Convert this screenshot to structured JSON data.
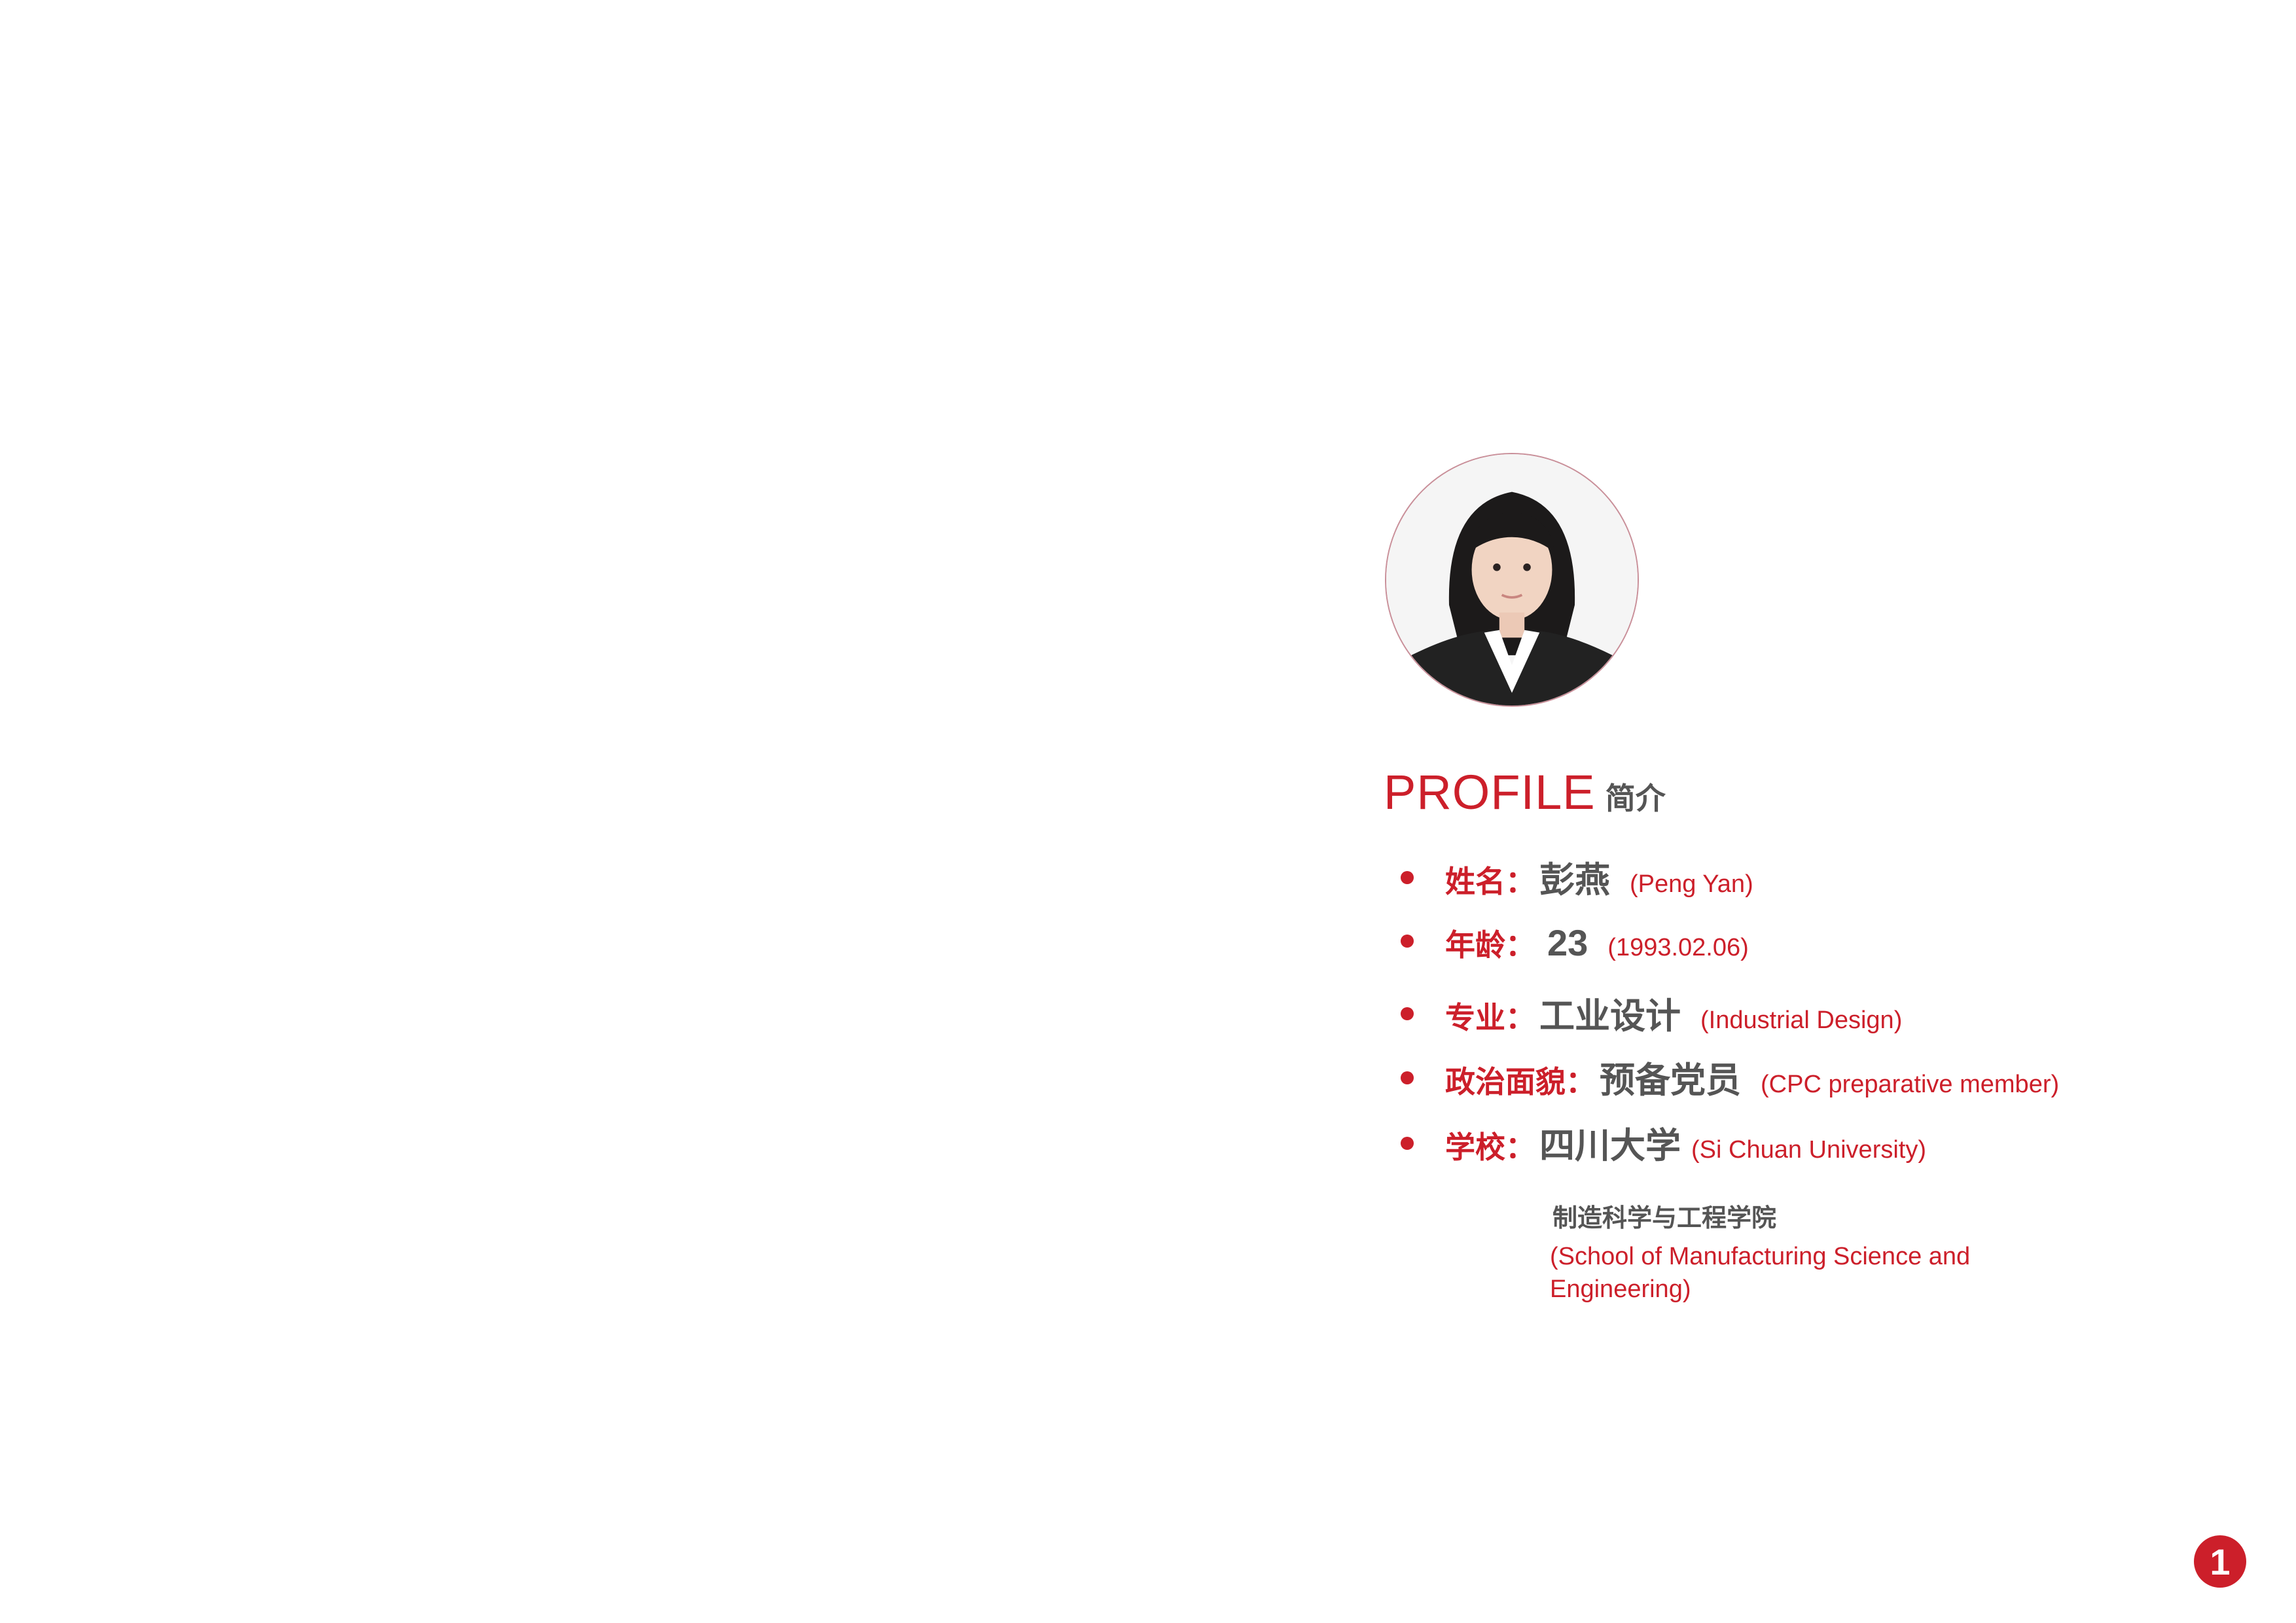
{
  "heading": {
    "en": "PROFILE",
    "cn": "简介"
  },
  "rows": [
    {
      "label": "姓名：",
      "value": "彭燕",
      "note": "(Peng Yan)"
    },
    {
      "label": "年龄：",
      "value": "23",
      "note": "(1993.02.06)"
    },
    {
      "label": "专业：",
      "value": "工业设计",
      "note": "(Industrial Design)"
    },
    {
      "label": "政治面貌：",
      "value": "预备党员",
      "note": "(CPC preparative member)"
    },
    {
      "label": "学校：",
      "value": "四川大学",
      "note": "(Si Chuan University)"
    }
  ],
  "school_detail": {
    "cn": "制造科学与工程学院",
    "en": "(School of Manufacturing Science and Engineering)"
  },
  "page_number": "1",
  "colors": {
    "accent": "#cc1f2a",
    "text_gray": "#555555",
    "avatar_border": "#c98f99"
  }
}
